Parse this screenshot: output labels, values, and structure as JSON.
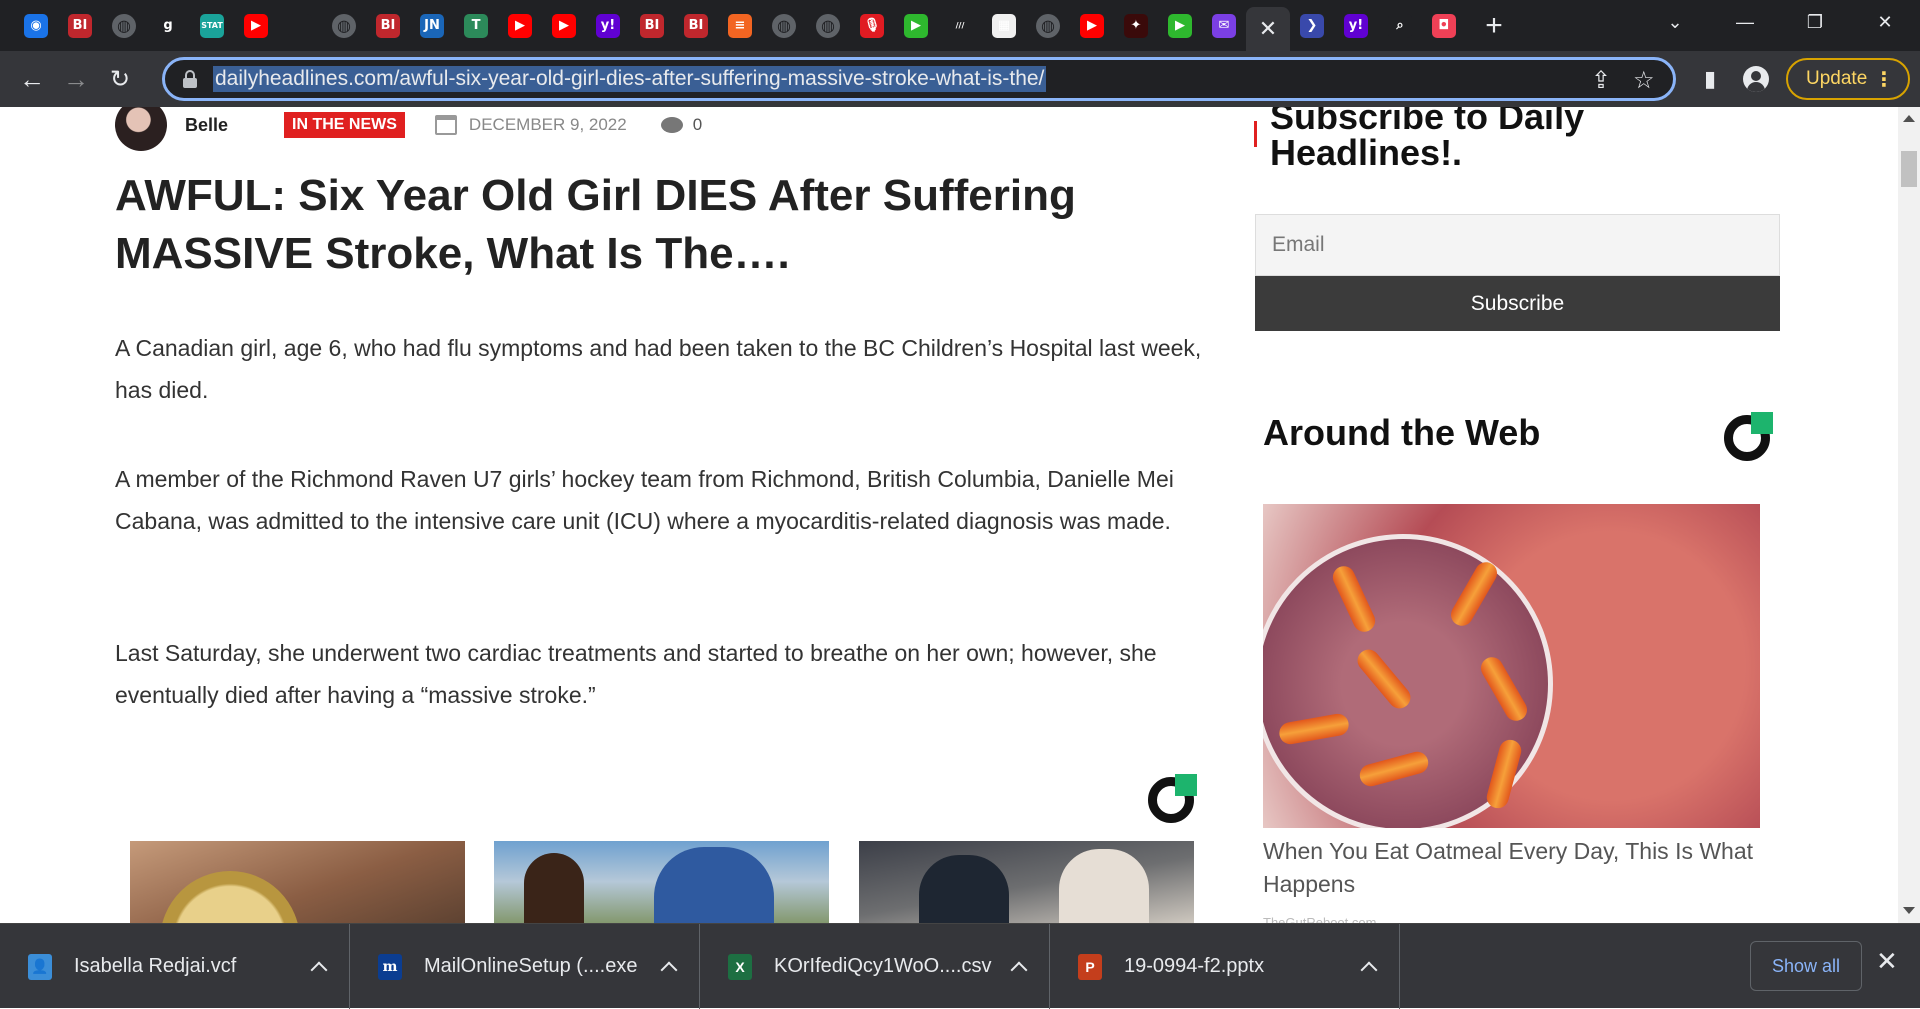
{
  "browser": {
    "tabs": [
      {
        "icon": "earth-icon",
        "glyph": "◉",
        "bg": "#1a73e8"
      },
      {
        "icon": "bi-icon",
        "glyph": "BI",
        "bg": "#c0272d"
      },
      {
        "icon": "globe-icon",
        "glyph": "◍",
        "bg": "#5f6368"
      },
      {
        "icon": "g-icon",
        "glyph": "g",
        "bg": "#202124"
      },
      {
        "icon": "stat-icon",
        "glyph": "STAT",
        "bg": "#1aa39a"
      },
      {
        "icon": "youtube-icon",
        "glyph": "▶",
        "bg": "#ff0000"
      },
      {
        "icon": "blank-icon",
        "glyph": "",
        "bg": "#202124"
      },
      {
        "icon": "globe-icon",
        "glyph": "◍",
        "bg": "#5f6368"
      },
      {
        "icon": "bi-icon",
        "glyph": "BI",
        "bg": "#c0272d"
      },
      {
        "icon": "jn-icon",
        "glyph": "JN",
        "bg": "#1a66b8"
      },
      {
        "icon": "t-icon",
        "glyph": "T",
        "bg": "#2c8a5a"
      },
      {
        "icon": "youtube-icon",
        "glyph": "▶",
        "bg": "#ff0000"
      },
      {
        "icon": "youtube-icon",
        "glyph": "▶",
        "bg": "#ff0000"
      },
      {
        "icon": "yahoo-icon",
        "glyph": "y!",
        "bg": "#6001d2"
      },
      {
        "icon": "bi-icon",
        "glyph": "BI",
        "bg": "#c0272d"
      },
      {
        "icon": "bi-icon",
        "glyph": "BI",
        "bg": "#c0272d"
      },
      {
        "icon": "bars-icon",
        "glyph": "≡",
        "bg": "#f26522"
      },
      {
        "icon": "globe-icon",
        "glyph": "◍",
        "bg": "#5f6368"
      },
      {
        "icon": "globe-icon",
        "glyph": "◍",
        "bg": "#5f6368"
      },
      {
        "icon": "mic-icon",
        "glyph": "🎙",
        "bg": "#e01b22"
      },
      {
        "icon": "play-icon",
        "glyph": "▶",
        "bg": "#2eb82e"
      },
      {
        "icon": "slash-icon",
        "glyph": "///",
        "bg": "#202124"
      },
      {
        "icon": "pattern-icon",
        "glyph": "▦",
        "bg": "#f0f0f0"
      },
      {
        "icon": "globe-icon",
        "glyph": "◍",
        "bg": "#5f6368"
      },
      {
        "icon": "youtube-icon",
        "glyph": "▶",
        "bg": "#ff0000"
      },
      {
        "icon": "dark-red-icon",
        "glyph": "✦",
        "bg": "#3a0a0a"
      },
      {
        "icon": "play-icon",
        "glyph": "▶",
        "bg": "#2eb82e"
      },
      {
        "icon": "mail-icon",
        "glyph": "✉",
        "bg": "#7b3fe4"
      },
      {
        "icon": "close-icon",
        "glyph": "✕",
        "bg": "#35363a",
        "active": true
      },
      {
        "icon": "arrow-icon",
        "glyph": "❯",
        "bg": "#3949ab"
      },
      {
        "icon": "yahoo-icon",
        "glyph": "y!",
        "bg": "#6001d2"
      },
      {
        "icon": "search-icon",
        "glyph": "⌕",
        "bg": "#202124"
      },
      {
        "icon": "pocket-icon",
        "glyph": "◘",
        "bg": "#ef4056"
      }
    ],
    "url": "dailyheadlines.com/awful-six-year-old-girl-dies-after-suffering-massive-stroke-what-is-the/",
    "update_label": "Update"
  },
  "article": {
    "author": "Belle",
    "category": "IN THE NEWS",
    "date": "DECEMBER 9, 2022",
    "comment_count": "0",
    "headline": "AWFUL: Six Year Old Girl DIES After Suffering MASSIVE Stroke, What Is The….",
    "paragraphs": [
      "A Canadian girl, age 6, who had flu symptoms and had been taken to the BC Children’s Hospital last week, has died.",
      "A member of the Richmond Raven U7 girls’ hockey team from Richmond, British Columbia, Danielle Mei Cabana, was admitted to the intensive care unit (ICU) where a myocarditis-related diagnosis was made.",
      "Last Saturday, she underwent two cardiac treatments and started to breathe on her own; however, she eventually died after having a “massive stroke.”"
    ]
  },
  "sidebar": {
    "subscribe_title": "Subscribe to Daily Headlines!.",
    "email_placeholder": "Email",
    "subscribe_label": "Subscribe",
    "around_title": "Around the Web",
    "promo_caption": "When You Eat Oatmeal Every Day, This Is What Happens",
    "promo_source": "TheGutReboot.com"
  },
  "downloads": {
    "items": [
      {
        "name": "Isabella Redjai.vcf",
        "icon": "contact-icon",
        "color": "#3b8ed8",
        "glyph": "👤"
      },
      {
        "name": "MailOnlineSetup (....exe",
        "icon": "mailonline-icon",
        "color": "#0b3d91",
        "glyph": "m"
      },
      {
        "name": "KOrIfediQcy1WoO....csv",
        "icon": "excel-icon",
        "color": "#1d6f42",
        "glyph": "X"
      },
      {
        "name": "19-0994-f2.pptx",
        "icon": "powerpoint-icon",
        "color": "#c43e1c",
        "glyph": "P"
      }
    ],
    "show_all_label": "Show all"
  }
}
